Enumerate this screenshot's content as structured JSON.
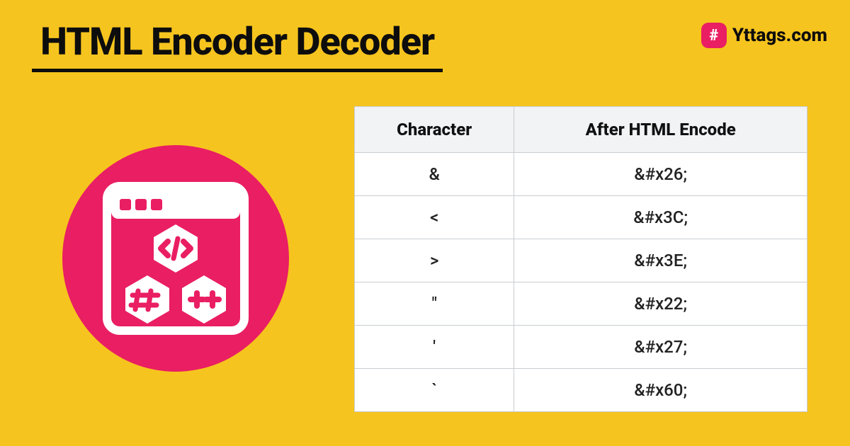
{
  "title": "HTML Encoder Decoder",
  "brand": {
    "icon_char": "#",
    "text": "Yttags.com"
  },
  "table": {
    "headers": [
      "Character",
      "After HTML Encode"
    ],
    "rows": [
      {
        "char": "&",
        "encoded": "&#x26;"
      },
      {
        "char": "<",
        "encoded": "&#x3C;"
      },
      {
        "char": ">",
        "encoded": "&#x3E;"
      },
      {
        "char": "\"",
        "encoded": "&#x22;"
      },
      {
        "char": "'",
        "encoded": "&#x27;"
      },
      {
        "char": "`",
        "encoded": "&#x60;"
      }
    ]
  }
}
